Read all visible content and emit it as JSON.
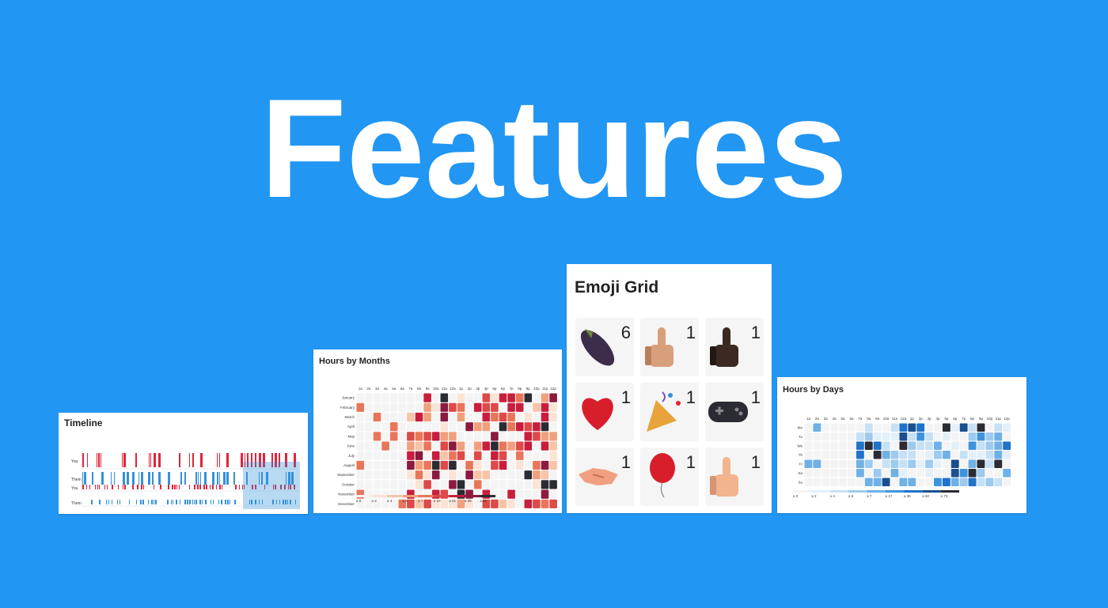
{
  "hero": {
    "title": "Features"
  },
  "timeline": {
    "title": "Timeline",
    "rows": [
      "You",
      "Them",
      "You",
      "Them"
    ]
  },
  "hours_by_months": {
    "title": "Hours by Months",
    "hours": [
      "1a",
      "2a",
      "3a",
      "4a",
      "5a",
      "6a",
      "7a",
      "8a",
      "9a",
      "10a",
      "11a",
      "12a",
      "1p",
      "2p",
      "3p",
      "4p",
      "5p",
      "6p",
      "7p",
      "8p",
      "9p",
      "10p",
      "11p",
      "12p"
    ],
    "months": [
      "January",
      "February",
      "March",
      "April",
      "May",
      "June",
      "July",
      "August",
      "September",
      "October",
      "November",
      "December"
    ],
    "legend": [
      "≥ 0",
      "≥ 2",
      "≥ 4",
      "≥ 5",
      "≥ 7",
      "≥ 10",
      "≥ 21",
      "≥ 46",
      "≥ 81"
    ],
    "colors": [
      "#f4f4f4",
      "#fbe3d6",
      "#f7c4a8",
      "#f1a07d",
      "#e8765a",
      "#dd4a48",
      "#c81e3c",
      "#8b1a3e",
      "#2b2b33"
    ]
  },
  "emoji_grid": {
    "title": "Emoji Grid",
    "cells": [
      {
        "icon": "eggplant-icon",
        "count": "6"
      },
      {
        "icon": "thumbs-up-light-icon",
        "count": "1"
      },
      {
        "icon": "thumbs-up-dark-icon",
        "count": "1"
      },
      {
        "icon": "red-heart-icon",
        "count": "1"
      },
      {
        "icon": "party-popper-icon",
        "count": "1"
      },
      {
        "icon": "game-controller-icon",
        "count": "1"
      },
      {
        "icon": "handshake-icon",
        "count": "1"
      },
      {
        "icon": "balloon-icon",
        "count": "1"
      },
      {
        "icon": "thumbs-up-medium-icon",
        "count": "1"
      }
    ]
  },
  "hours_by_days": {
    "title": "Hours by Days",
    "hours": [
      "1a",
      "2a",
      "3a",
      "4a",
      "5a",
      "6a",
      "7a",
      "8a",
      "9a",
      "10a",
      "11a",
      "12a",
      "1p",
      "2p",
      "3p",
      "4p",
      "5p",
      "6p",
      "7p",
      "8p",
      "9p",
      "10p",
      "11p",
      "12p"
    ],
    "days": [
      "Mo",
      "Tu",
      "We",
      "Th",
      "Fr",
      "Sa",
      "Su"
    ],
    "legend": [
      "≥ 0",
      "≥ 2",
      "≥ 4",
      "≥ 5",
      "≥ 7",
      "≥ 17",
      "≥ 36",
      "≥ 50",
      "≥ 73"
    ],
    "colors": [
      "#f4f4f4",
      "#e3f0fa",
      "#c6e0f5",
      "#9dcaee",
      "#6fb1e6",
      "#3e94dc",
      "#1f73c8",
      "#1a4f8f",
      "#2b2b33"
    ]
  }
}
